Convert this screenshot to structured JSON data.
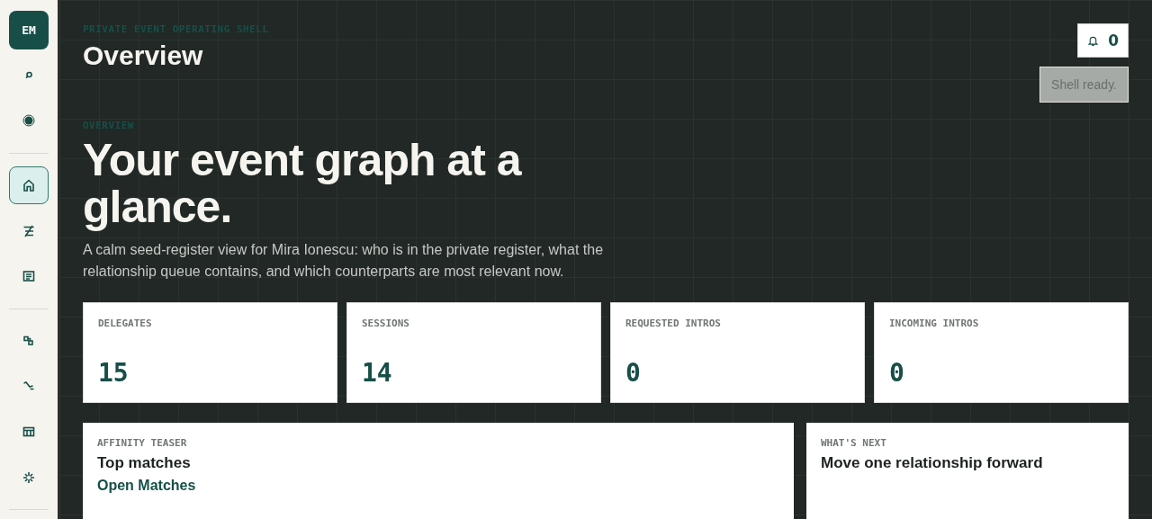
{
  "sidebar": {
    "avatar": "EM",
    "groups": [
      [
        {
          "selected": false
        },
        {
          "selected": false
        }
      ],
      [
        {
          "selected": true
        },
        {
          "selected": false
        },
        {
          "selected": false
        }
      ],
      [
        {
          "selected": false
        },
        {
          "selected": false
        },
        {
          "selected": false
        },
        {
          "selected": false
        }
      ]
    ]
  },
  "header": {
    "eyebrow": "PRIVATE EVENT OPERATING SHELL",
    "title": "Overview",
    "notifications": "0",
    "status": "Shell ready."
  },
  "hero": {
    "eyebrow": "OVERVIEW",
    "title": "Your event graph at a glance.",
    "description": "A calm seed-register view for Mira Ionescu: who is in the private register, what the relationship queue contains, and which counterparts are most relevant now."
  },
  "stats": [
    {
      "label": "DELEGATES",
      "value": "15"
    },
    {
      "label": "SESSIONS",
      "value": "14"
    },
    {
      "label": "REQUESTED INTROS",
      "value": "0"
    },
    {
      "label": "INCOMING INTROS",
      "value": "0"
    }
  ],
  "cards": [
    {
      "eyebrow": "AFFINITY TEASER",
      "title": "Top matches",
      "link": "Open Matches"
    },
    {
      "eyebrow": "WHAT'S NEXT",
      "title": "Move one relationship forward"
    }
  ]
}
